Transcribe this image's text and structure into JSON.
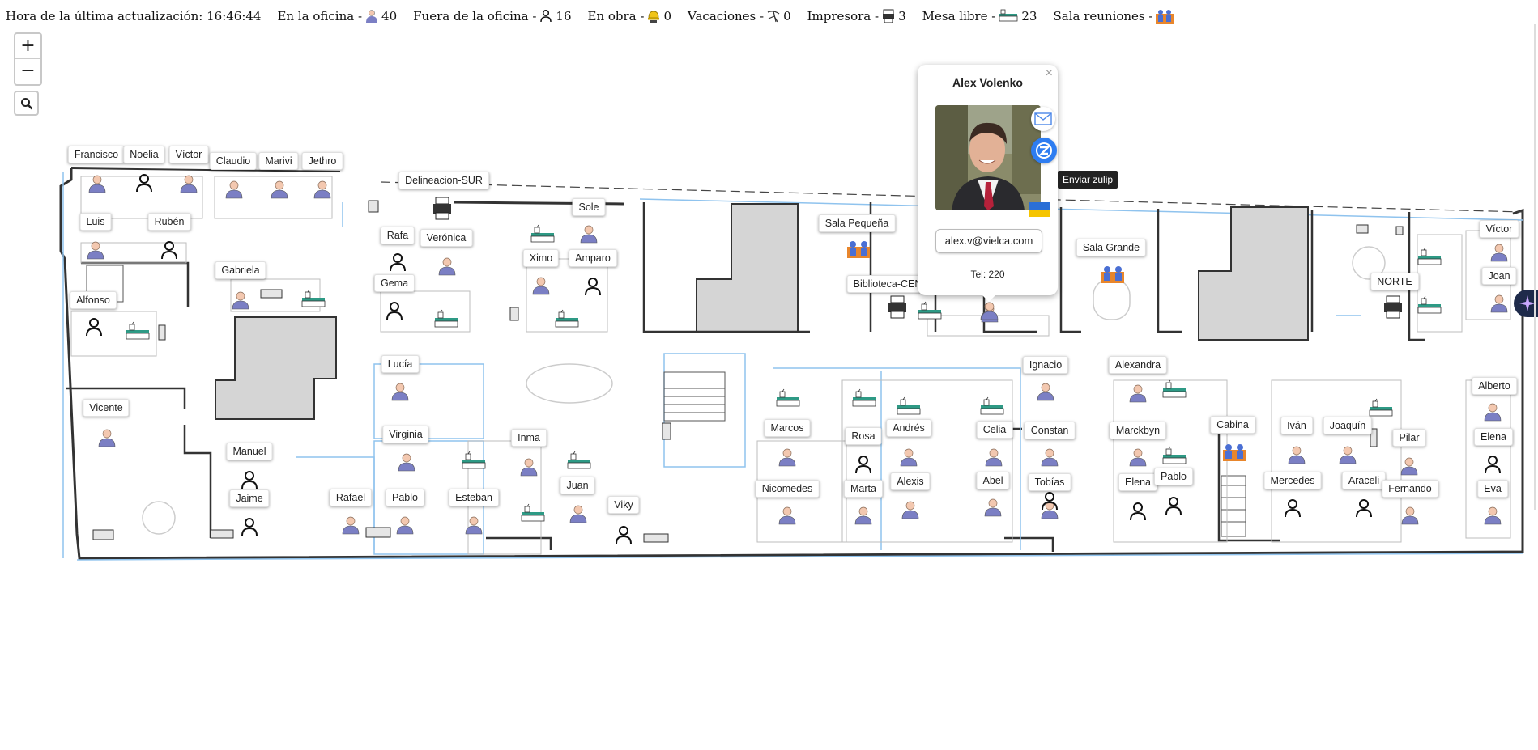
{
  "status": {
    "last_update_label": "Hora de la última actualización:",
    "last_update_time": "16:46:44",
    "in_office_label": "En la oficina -",
    "in_office_count": "40",
    "out_office_label": "Fuera de la oficina -",
    "out_office_count": "16",
    "on_site_label": "En obra -",
    "on_site_count": "0",
    "vacation_label": "Vacaciones -",
    "vacation_count": "0",
    "printer_label": "Impresora -",
    "printer_count": "3",
    "free_desk_label": "Mesa libre -",
    "free_desk_count": "23",
    "meeting_label": "Sala reuniones -"
  },
  "controls": {
    "zoom_in": "+",
    "zoom_out": "−"
  },
  "labels": {
    "francisco": "Francisco",
    "noelia": "Noelia",
    "victor1": "Víctor",
    "claudio": "Claudio",
    "marivi": "Marivi",
    "jethro": "Jethro",
    "delineacion": "Delineacion-SUR",
    "luis": "Luis",
    "ruben": "Rubén",
    "sole": "Sole",
    "rafa": "Rafa",
    "veronica": "Verónica",
    "gabriela": "Gabriela",
    "ximo": "Ximo",
    "amparo": "Amparo",
    "gema": "Gema",
    "alfonso": "Alfonso",
    "sala_pequena": "Sala Pequeña",
    "biblioteca": "Biblioteca-CEN",
    "sala_grande": "Sala Grande",
    "victor2": "Víctor",
    "joan": "Joan",
    "norte": "NORTE",
    "lucia": "Lucía",
    "ignacio": "Ignacio",
    "alexandra": "Alexandra",
    "alberto": "Alberto",
    "vicente": "Vicente",
    "virginia": "Virginia",
    "inma": "Inma",
    "marcos": "Marcos",
    "rosa": "Rosa",
    "andres": "Andrés",
    "celia": "Celia",
    "constan": "Constan",
    "marckbyn": "Marckbyn",
    "cabina": "Cabina",
    "ivan": "Iván",
    "joaquin": "Joaquín",
    "pilar": "Pilar",
    "elena1": "Elena",
    "manuel": "Manuel",
    "juan": "Juan",
    "nicomedes": "Nicomedes",
    "marta": "Marta",
    "alexis": "Alexis",
    "abel": "Abel",
    "tobias": "Tobías",
    "elena2": "Elena",
    "pablo1": "Pablo",
    "mercedes": "Mercedes",
    "araceli": "Araceli",
    "fernando": "Fernando",
    "eva": "Eva",
    "jaime": "Jaime",
    "rafael": "Rafael",
    "pablo2": "Pablo",
    "esteban": "Esteban",
    "viky": "Viky"
  },
  "popup": {
    "name": "Alex Volenko",
    "close": "×",
    "email": "alex.v@vielca.com",
    "tel": "Tel: 220",
    "tooltip": "Enviar zulip"
  },
  "colors": {
    "accent_person": "#7b7fc4",
    "skin": "#f3c8b0",
    "desk": "#2e9a85",
    "wall": "#333333",
    "room_fill": "#d5d5d5",
    "glass": "#8fc3ee"
  }
}
